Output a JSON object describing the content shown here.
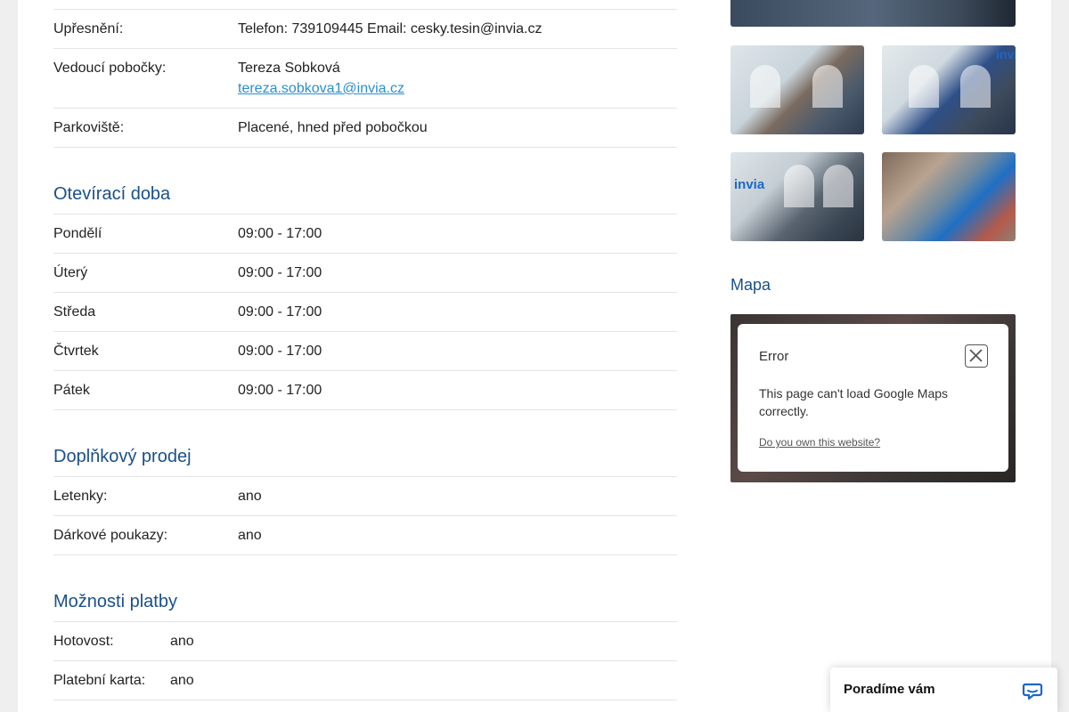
{
  "details": {
    "rows": [
      {
        "label": "Upřesnění:",
        "value": "Telefon: 739109445 Email: cesky.tesin@invia.cz"
      },
      {
        "label": "Vedoucí pobočky:",
        "value": "Tereza Sobková",
        "email": "tereza.sobkova1@invia.cz"
      },
      {
        "label": "Parkoviště:",
        "value": "Placené, hned před pobočkou"
      }
    ]
  },
  "opening_hours": {
    "title": "Otevírací doba",
    "days": [
      {
        "day": "Pondělí",
        "hours": "09:00 - 17:00"
      },
      {
        "day": "Úterý",
        "hours": "09:00 - 17:00"
      },
      {
        "day": "Středa",
        "hours": "09:00 - 17:00"
      },
      {
        "day": "Čtvrtek",
        "hours": "09:00 - 17:00"
      },
      {
        "day": "Pátek",
        "hours": "09:00 - 17:00"
      }
    ]
  },
  "extra_sales": {
    "title": "Doplňkový prodej",
    "rows": [
      {
        "label": "Letenky:",
        "value": "ano"
      },
      {
        "label": "Dárkové poukazy:",
        "value": "ano"
      }
    ]
  },
  "payment": {
    "title": "Možnosti platby",
    "rows": [
      {
        "label": "Hotovost:",
        "value": "ano"
      },
      {
        "label": "Platební karta:",
        "value": "ano"
      }
    ]
  },
  "gallery": {
    "logo_text": "invia"
  },
  "map": {
    "title": "Mapa",
    "error_title": "Error",
    "error_message": "This page can't load Google Maps correctly.",
    "error_link": "Do you own this website?"
  },
  "chat": {
    "label": "Poradíme vám",
    "accent": "#1d66c7"
  },
  "colors": {
    "heading": "#1a4f8b",
    "link": "#2a8fd0"
  }
}
